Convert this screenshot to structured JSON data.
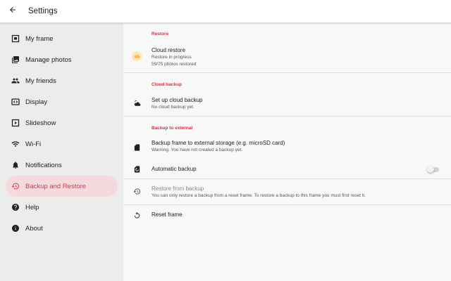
{
  "header": {
    "title": "Settings",
    "back_icon": "arrow-left-icon"
  },
  "sidebar": {
    "items": [
      {
        "label": "My frame",
        "icon": "frame-icon"
      },
      {
        "label": "Manage photos",
        "icon": "photos-icon"
      },
      {
        "label": "My friends",
        "icon": "people-icon"
      },
      {
        "label": "Display",
        "icon": "display-icon"
      },
      {
        "label": "Slideshow",
        "icon": "slideshow-icon"
      },
      {
        "label": "Wi-Fi",
        "icon": "wifi-icon"
      },
      {
        "label": "Notifications",
        "icon": "bell-icon"
      },
      {
        "label": "Backup and Restore",
        "icon": "restore-icon",
        "active": true
      },
      {
        "label": "Help",
        "icon": "help-icon"
      },
      {
        "label": "About",
        "icon": "info-icon"
      }
    ]
  },
  "main": {
    "restore": {
      "header": "Restore",
      "cloud_restore": {
        "title": "Cloud restore",
        "status": "Restore in progress",
        "progress": "59/75 photos restored",
        "icon": "cloud-upload-icon"
      }
    },
    "cloud_backup": {
      "header": "Cloud backup",
      "setup": {
        "title": "Set up cloud backup",
        "subtitle": "No cloud backup yet.",
        "icon": "cloud-moon-icon"
      }
    },
    "backup_external": {
      "header": "Backup to external",
      "backup_frame": {
        "title": "Backup frame to external storage (e.g. microSD card)",
        "subtitle": "Warning. You have not created a backup yet.",
        "icon": "sd-card-icon"
      },
      "automatic_backup": {
        "title": "Automatic backup",
        "icon": "sd-auto-icon",
        "enabled": false
      },
      "restore_from_backup": {
        "title": "Restore from backup",
        "subtitle": "You can only restore a backup from a reset frame. To restore a backup to this frame you must first reset it.",
        "icon": "restore-icon"
      },
      "reset_frame": {
        "title": "Reset frame",
        "icon": "reset-icon"
      }
    }
  },
  "colors": {
    "accent": "#e0293f",
    "active_bg": "#f6d9dc",
    "sidebar_bg": "#ececec",
    "main_bg": "#f8f8f8",
    "cloud_icon": "#f5b833"
  }
}
